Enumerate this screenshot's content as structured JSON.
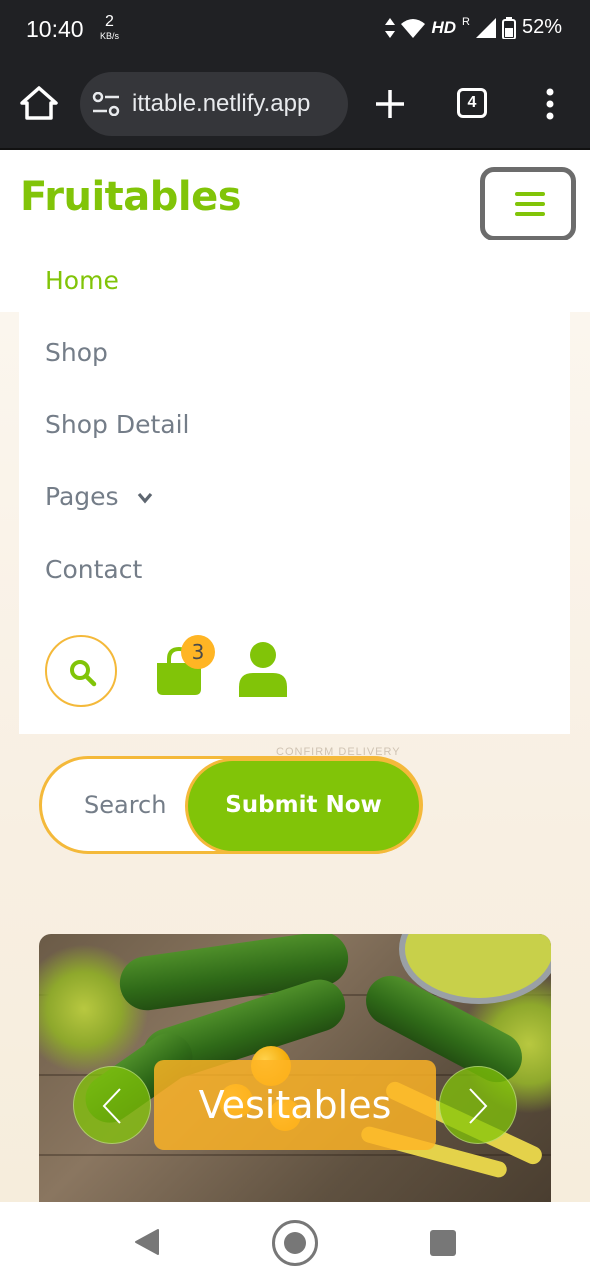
{
  "status_bar": {
    "time": "10:40",
    "net_speed": "2",
    "net_unit": "KB/s",
    "network_type": "HD",
    "roaming": "R",
    "battery": "52%"
  },
  "browser": {
    "url": "ittable.netlify.app",
    "tab_count": "4"
  },
  "header": {
    "logo": "Fruitables"
  },
  "menu": {
    "items": [
      {
        "label": "Home",
        "active": true
      },
      {
        "label": "Shop",
        "active": false
      },
      {
        "label": "Shop Detail",
        "active": false
      },
      {
        "label": "Pages",
        "active": false,
        "has_dropdown": true
      },
      {
        "label": "Contact",
        "active": false
      }
    ],
    "cart_count": "3"
  },
  "hero": {
    "background_text": "CONFIRM DELIVERY",
    "search_placeholder": "Search",
    "submit_label": "Submit Now"
  },
  "carousel": {
    "caption": "Vesitables"
  },
  "colors": {
    "brand_green": "#81c408",
    "accent_orange": "#ffb524",
    "border_yellow": "#f4b93a",
    "text_gray": "#747d88"
  },
  "icons": {
    "home": "home-icon",
    "site_settings": "tune-icon",
    "new_tab": "plus-icon",
    "more": "more-vert-icon",
    "menu": "hamburger-icon",
    "search": "search-icon",
    "cart": "shopping-bag-icon",
    "user": "user-icon",
    "prev": "chevron-left-icon",
    "next": "chevron-right-icon"
  }
}
